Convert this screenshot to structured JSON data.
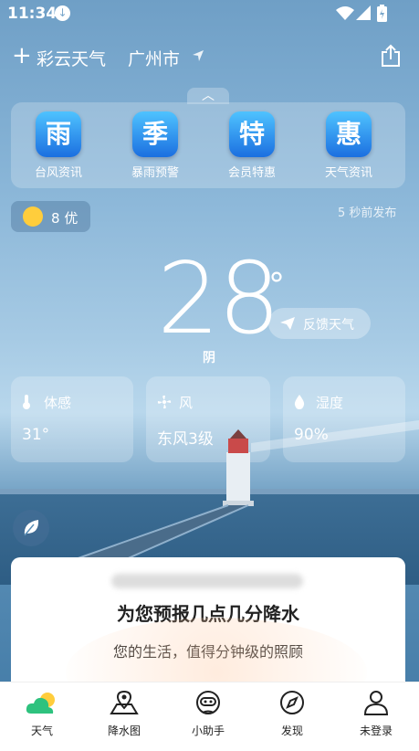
{
  "status": {
    "time": "11:34"
  },
  "header": {
    "app_name": "彩云天气",
    "city": "广州市"
  },
  "menu": [
    {
      "glyph": "雨",
      "label": "台风资讯"
    },
    {
      "glyph": "季",
      "label": "暴雨预警"
    },
    {
      "glyph": "特",
      "label": "会员特惠"
    },
    {
      "glyph": "惠",
      "label": "天气资讯"
    }
  ],
  "aqi": {
    "value": "8",
    "level": "优"
  },
  "published": "5 秒前发布",
  "weather": {
    "temperature": "28",
    "degree": "°",
    "condition": "阴",
    "feedback_label": "反馈天气"
  },
  "cards": [
    {
      "title": "体感",
      "value": "31°"
    },
    {
      "title": "风",
      "value": "东风3级"
    },
    {
      "title": "湿度",
      "value": "90%"
    }
  ],
  "sheet": {
    "title": "为您预报几点几分降水",
    "subtitle": "您的生活，值得分钟级的照顾"
  },
  "tabs": [
    {
      "label": "天气"
    },
    {
      "label": "降水图"
    },
    {
      "label": "小助手"
    },
    {
      "label": "发现"
    },
    {
      "label": "未登录"
    }
  ],
  "colors": {
    "menu_icon_top": "#4fc3ff",
    "menu_icon_bottom": "#1b6fe0",
    "weather_tab_green": "#2ec27e",
    "sun": "#ffcd3c"
  }
}
